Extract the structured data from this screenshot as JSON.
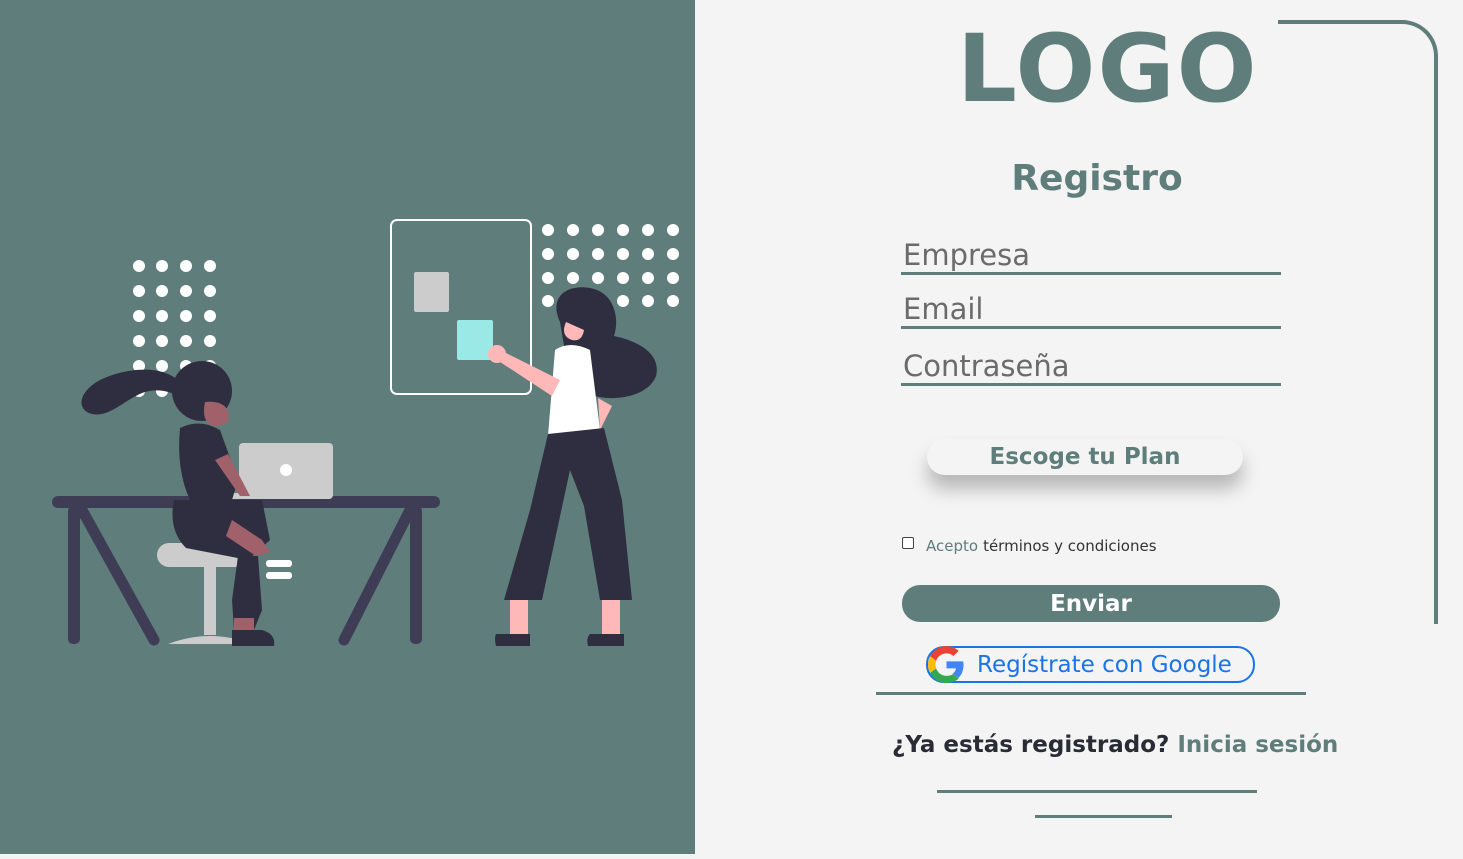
{
  "brand": {
    "logo": "LOGO",
    "primary_color": "#5f7d7a",
    "background": "#f4f4f4",
    "link_color": "#1a73e8"
  },
  "illustration": {
    "name": "people-working-illustration"
  },
  "form": {
    "title": "Registro",
    "fields": [
      {
        "label": "Empresa"
      },
      {
        "label": "Email"
      },
      {
        "label": "Contraseña"
      }
    ],
    "plan_button": "Escoge tu Plan",
    "terms": {
      "accept": "Acepto",
      "link": "términos y condiciones",
      "checked": false
    },
    "submit_button": "Enviar",
    "google_button": {
      "label": "Regístrate con Google",
      "icon": "google-icon"
    },
    "login_prompt": {
      "question": "¿Ya estás registrado?",
      "link": "Inicia sesión"
    }
  }
}
